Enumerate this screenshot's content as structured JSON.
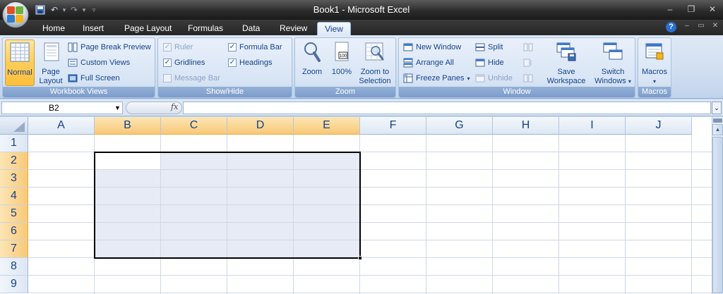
{
  "window": {
    "title_doc": "Book1",
    "title_sep": " - ",
    "title_app": "Microsoft Excel"
  },
  "tabs": [
    {
      "label": "Home",
      "active": false
    },
    {
      "label": "Insert",
      "active": false
    },
    {
      "label": "Page Layout",
      "active": false
    },
    {
      "label": "Formulas",
      "active": false
    },
    {
      "label": "Data",
      "active": false
    },
    {
      "label": "Review",
      "active": false
    },
    {
      "label": "View",
      "active": true
    }
  ],
  "ribbon": {
    "workbook_views": {
      "label": "Workbook Views",
      "normal": "Normal",
      "page_layout_1": "Page",
      "page_layout_2": "Layout",
      "page_break_preview": "Page Break Preview",
      "custom_views": "Custom Views",
      "full_screen": "Full Screen"
    },
    "show_hide": {
      "label": "Show/Hide",
      "ruler": "Ruler",
      "ruler_checked": true,
      "ruler_enabled": false,
      "gridlines": "Gridlines",
      "gridlines_checked": true,
      "message_bar": "Message Bar",
      "message_bar_checked": false,
      "message_bar_enabled": false,
      "formula_bar": "Formula Bar",
      "formula_bar_checked": true,
      "headings": "Headings",
      "headings_checked": true
    },
    "zoom": {
      "label": "Zoom",
      "zoom": "Zoom",
      "hundred": "100%",
      "zoom_sel_1": "Zoom to",
      "zoom_sel_2": "Selection"
    },
    "window": {
      "label": "Window",
      "new_window": "New Window",
      "arrange_all": "Arrange All",
      "freeze_panes": "Freeze Panes",
      "split": "Split",
      "hide": "Hide",
      "unhide": "Unhide",
      "save_ws_1": "Save",
      "save_ws_2": "Workspace",
      "switch_1": "Switch",
      "switch_2": "Windows"
    },
    "macros": {
      "label": "Macros",
      "macros": "Macros"
    }
  },
  "formula_bar": {
    "name_box": "B2",
    "fx": "fx",
    "value": ""
  },
  "grid": {
    "columns": [
      "A",
      "B",
      "C",
      "D",
      "E",
      "F",
      "G",
      "H",
      "I",
      "J"
    ],
    "selected_columns": [
      "B",
      "C",
      "D",
      "E"
    ],
    "rows": [
      "1",
      "2",
      "3",
      "4",
      "5",
      "6",
      "7",
      "8",
      "9"
    ],
    "selected_rows": [
      "2",
      "3",
      "4",
      "5",
      "6",
      "7"
    ],
    "active_cell": "B2",
    "selection_range": "B2:E7"
  },
  "colors": {
    "selection_fill": "#e6ebf5",
    "header_selected": "#f8c978",
    "ribbon_group_label": "#7d9ccb",
    "normal_view_active": "#ffcd5a"
  }
}
